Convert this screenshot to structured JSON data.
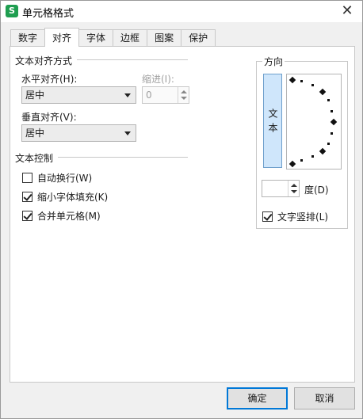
{
  "window": {
    "title": "单元格格式",
    "app_icon": "S",
    "close_glyph": "✕"
  },
  "tabs": [
    {
      "label": "数字",
      "active": false
    },
    {
      "label": "对齐",
      "active": true
    },
    {
      "label": "字体",
      "active": false
    },
    {
      "label": "边框",
      "active": false
    },
    {
      "label": "图案",
      "active": false
    },
    {
      "label": "保护",
      "active": false
    }
  ],
  "alignment": {
    "group_label": "文本对齐方式",
    "horizontal_label": "水平对齐(H):",
    "horizontal_value": "居中",
    "indent_label": "缩进(I):",
    "indent_value": "0",
    "vertical_label": "垂直对齐(V):",
    "vertical_value": "居中"
  },
  "text_control": {
    "group_label": "文本控制",
    "wrap_label": "自动换行(W)",
    "wrap_checked": false,
    "shrink_label": "缩小字体填充(K)",
    "shrink_checked": true,
    "merge_label": "合并单元格(M)",
    "merge_checked": true
  },
  "orientation": {
    "group_label": "方向",
    "vertical_text": "文本",
    "degree_value": "",
    "degree_label": "度(D)",
    "vertical_stack_label": "文字竖排(L)",
    "vertical_stack_checked": true
  },
  "buttons": {
    "ok": "确定",
    "cancel": "取消"
  }
}
